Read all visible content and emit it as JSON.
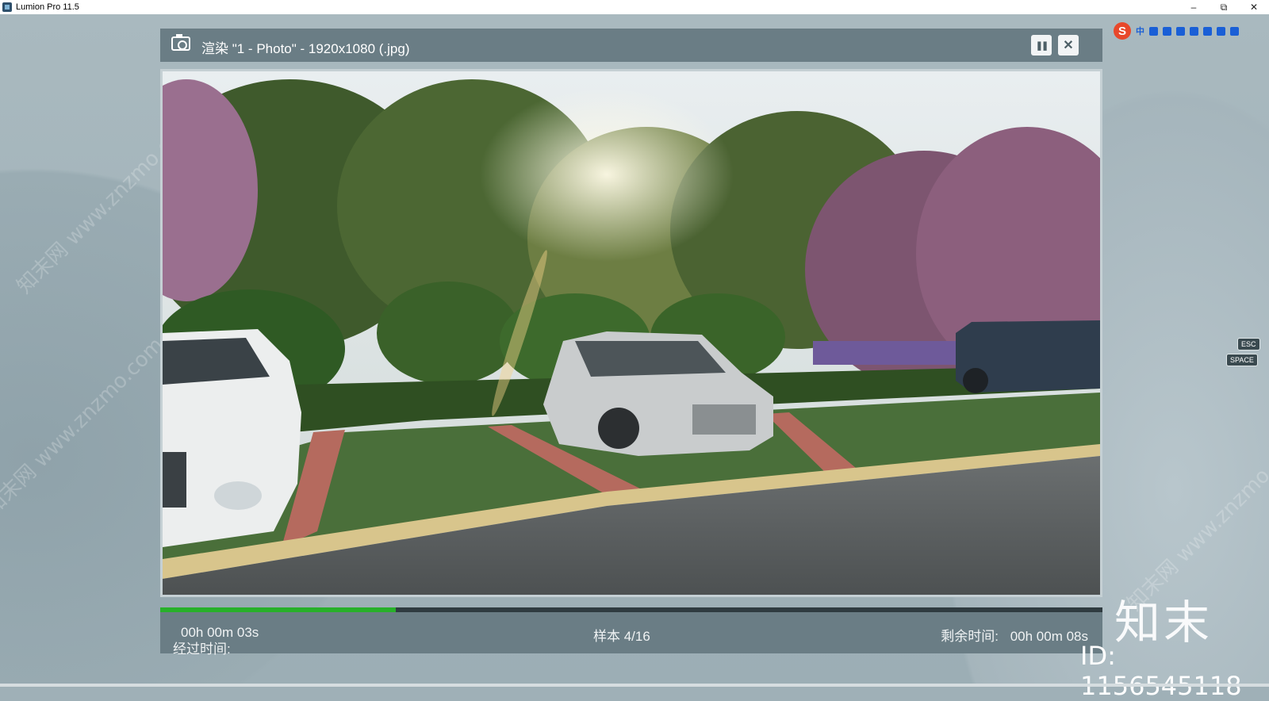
{
  "window": {
    "title": "Lumion Pro 11.5",
    "minimize": "–",
    "restore": "⧉",
    "close": "✕"
  },
  "ime_toolbar": {
    "logo": "S",
    "mode": "中"
  },
  "render_dialog": {
    "title": "渲染 \"1 - Photo\" - 1920x1080 (.jpg)",
    "pause_icon": "pause-icon",
    "close_icon": "close-icon",
    "pause_label": "❚❚",
    "close_label": "✕",
    "progress": 0.25,
    "elapsed_label": "经过时间:",
    "elapsed_value": "00h 00m 03s",
    "samples": "样本 4/16",
    "remaining_label": "剩余时间:",
    "remaining_value": "00h 00m 08s"
  },
  "key_hints": {
    "esc": "ESC",
    "space": "SPACE"
  },
  "watermark": {
    "brand": "知末",
    "id": "ID: 1156545118",
    "site": "知末网 www.znzmo.com"
  },
  "colors": {
    "progress": "#27b02a",
    "panel": "#6a7d85"
  }
}
